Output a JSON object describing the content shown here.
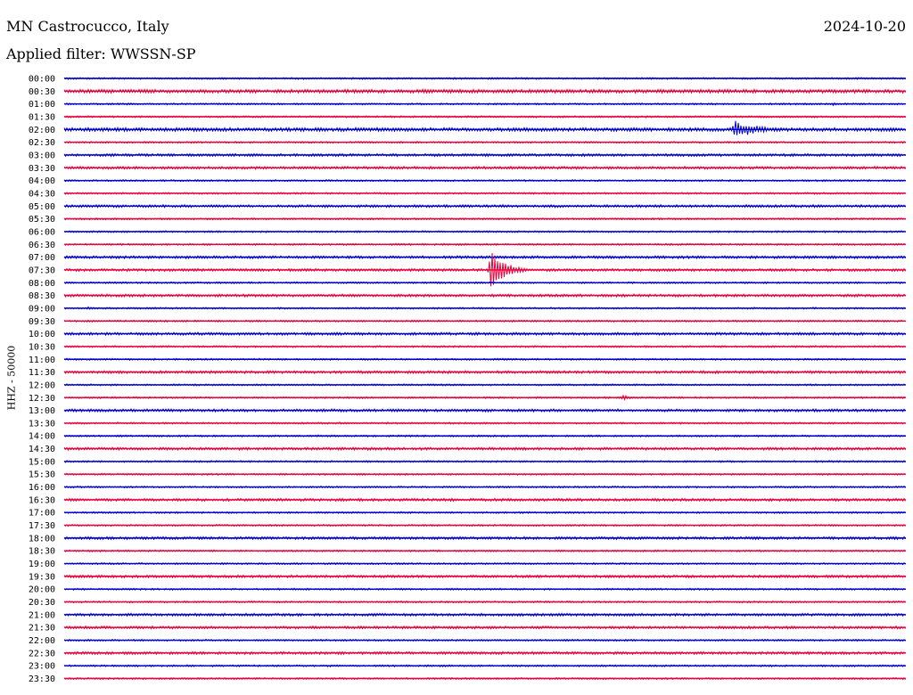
{
  "header": {
    "station": "MN Castrocucco, Italy",
    "date": "2024-10-20",
    "filter": "Applied filter: WWSSN-SP"
  },
  "chart_data": {
    "type": "line",
    "ylabel": "HHZ - 50000",
    "row_labels": [
      "00:00",
      "00:30",
      "01:00",
      "01:30",
      "02:00",
      "02:30",
      "03:00",
      "03:30",
      "04:00",
      "04:30",
      "05:00",
      "05:30",
      "06:00",
      "06:30",
      "07:00",
      "07:30",
      "08:00",
      "08:30",
      "09:00",
      "09:30",
      "10:00",
      "10:30",
      "11:00",
      "11:30",
      "12:00",
      "12:30",
      "13:00",
      "13:30",
      "14:00",
      "14:30",
      "15:00",
      "15:30",
      "16:00",
      "16:30",
      "17:00",
      "17:30",
      "18:00",
      "18:30",
      "19:00",
      "19:30",
      "20:00",
      "20:30",
      "21:00",
      "21:30",
      "22:00",
      "22:30",
      "23:00",
      "23:30"
    ],
    "row_minutes": 30,
    "colors": {
      "even": "#0000cc",
      "odd": "#e8003c"
    },
    "noise": [
      1,
      2,
      1,
      1,
      2,
      1,
      1.5,
      1.5,
      1,
      1,
      1.5,
      1,
      1,
      1,
      1.5,
      1.5,
      1,
      1.5,
      1,
      1,
      1.5,
      1,
      1,
      1.5,
      1,
      1,
      1.5,
      1,
      1,
      1.5,
      1,
      1,
      1,
      1.5,
      1,
      1,
      1.5,
      1,
      1,
      1.5,
      1,
      1,
      1.5,
      1.5,
      1,
      1.5,
      1,
      1
    ],
    "events": [
      {
        "row": 2,
        "minute": 27.3,
        "amplitude": 3,
        "duration_min": 0.6
      },
      {
        "row": 4,
        "minute": 10.8,
        "amplitude": 3,
        "duration_min": 0.9
      },
      {
        "row": 4,
        "minute": 23.8,
        "amplitude": 12,
        "duration_min": 2.3
      },
      {
        "row": 6,
        "minute": 18.7,
        "amplitude": 3,
        "duration_min": 0.8
      },
      {
        "row": 6,
        "minute": 22.0,
        "amplitude": 3,
        "duration_min": 0.3
      },
      {
        "row": 6,
        "minute": 23.1,
        "amplitude": 4,
        "duration_min": 0.4
      },
      {
        "row": 11,
        "minute": 24.0,
        "amplitude": 2,
        "duration_min": 0.4
      },
      {
        "row": 15,
        "minute": 8.5,
        "amplitude": 3,
        "duration_min": 0.5
      },
      {
        "row": 15,
        "minute": 15.1,
        "amplitude": 30,
        "duration_min": 1.4
      },
      {
        "row": 15,
        "minute": 21.0,
        "amplitude": 3,
        "duration_min": 0.6
      },
      {
        "row": 18,
        "minute": 0.8,
        "amplitude": 3,
        "duration_min": 0.8
      },
      {
        "row": 23,
        "minute": 22.0,
        "amplitude": 3,
        "duration_min": 0.5
      },
      {
        "row": 25,
        "minute": 19.8,
        "amplitude": 4,
        "duration_min": 1.0
      },
      {
        "row": 28,
        "minute": 27.3,
        "amplitude": 2,
        "duration_min": 0.3
      },
      {
        "row": 32,
        "minute": 0.5,
        "amplitude": 2,
        "duration_min": 0.2
      },
      {
        "row": 33,
        "minute": 27.8,
        "amplitude": 2,
        "duration_min": 1.5
      },
      {
        "row": 43,
        "minute": 18.4,
        "amplitude": 2,
        "duration_min": 0.5
      }
    ]
  }
}
